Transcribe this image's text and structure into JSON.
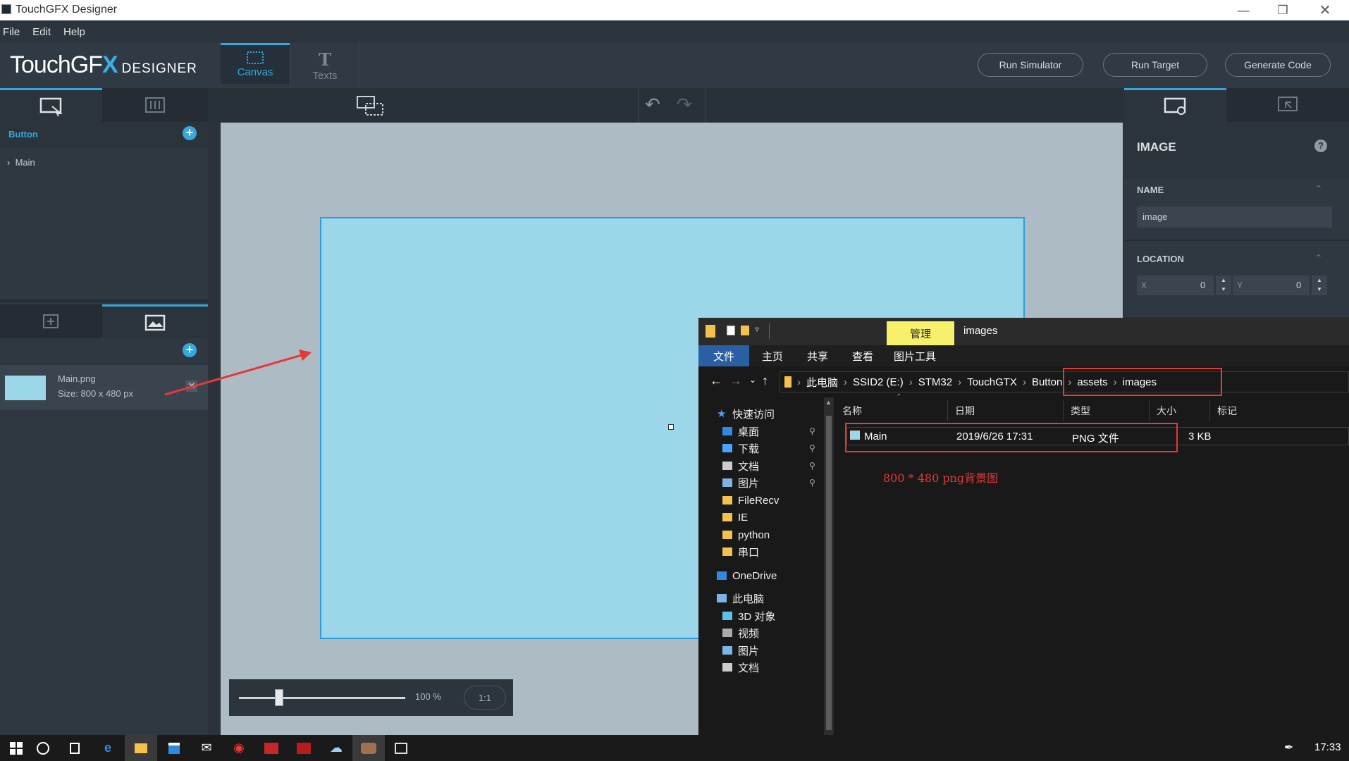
{
  "window": {
    "title": "TouchGFX Designer"
  },
  "menu": {
    "items": [
      "File",
      "Edit",
      "Help"
    ]
  },
  "header": {
    "logo_text": "TouchGF",
    "logo_x": "X",
    "logo_sub": "DESIGNER",
    "tabs": [
      {
        "label": "Canvas",
        "icon": "canvas-icon"
      },
      {
        "label": "Texts",
        "icon": "text-icon"
      }
    ],
    "buttons": [
      "Run Simulator",
      "Run Target",
      "Generate Code"
    ]
  },
  "left": {
    "project": "Button",
    "tree": [
      {
        "label": "Main"
      }
    ],
    "image": {
      "name": "Main.png",
      "size": "Size: 800 x 480 px"
    }
  },
  "zoom": {
    "percent": "100 %",
    "ratio": "1:1",
    "slider_fraction": 0.24
  },
  "properties": {
    "section_title": "IMAGE",
    "help": "?",
    "name_label": "NAME",
    "name_value": "image",
    "location_label": "LOCATION",
    "x_label": "X",
    "x_value": "0",
    "y_label": "Y",
    "y_value": "0"
  },
  "explorer": {
    "manage_tab": "管理",
    "folder_title": "images",
    "ribbon_tabs": [
      "文件",
      "主页",
      "共享",
      "查看",
      "图片工具"
    ],
    "breadcrumb": [
      "此电脑",
      "SSID2 (E:)",
      "STM32",
      "TouchGTX",
      "Button",
      "assets",
      "images"
    ],
    "columns": [
      "名称",
      "日期",
      "类型",
      "大小",
      "标记"
    ],
    "files": [
      {
        "name": "Main",
        "date": "2019/6/26 17:31",
        "type": "PNG 文件",
        "size": "3 KB"
      }
    ],
    "annotation": "800 * 480 png背景图",
    "sidebar": [
      {
        "label": "快速访问",
        "icon": "star-icon",
        "pinned": false
      },
      {
        "label": "桌面",
        "icon": "desktop-icon",
        "pinned": true
      },
      {
        "label": "下载",
        "icon": "download-icon",
        "pinned": true
      },
      {
        "label": "文档",
        "icon": "document-icon",
        "pinned": true
      },
      {
        "label": "图片",
        "icon": "pictures-icon",
        "pinned": true
      },
      {
        "label": "FileRecv",
        "icon": "folder-icon",
        "pinned": false
      },
      {
        "label": "IE",
        "icon": "folder-icon",
        "pinned": false
      },
      {
        "label": "python",
        "icon": "folder-icon",
        "pinned": false
      },
      {
        "label": "串口",
        "icon": "folder-icon",
        "pinned": false
      },
      {
        "label": "OneDrive",
        "icon": "cloud-icon",
        "pinned": false
      },
      {
        "label": "此电脑",
        "icon": "computer-icon",
        "pinned": false
      },
      {
        "label": "3D 对象",
        "icon": "cube-icon",
        "pinned": false
      },
      {
        "label": "视频",
        "icon": "video-icon",
        "pinned": false
      },
      {
        "label": "图片",
        "icon": "pictures-icon",
        "pinned": false
      },
      {
        "label": "文档",
        "icon": "document-icon",
        "pinned": false
      }
    ]
  },
  "taskbar": {
    "time": "17:33"
  },
  "colors": {
    "accent": "#35a8df",
    "highlight": "#e53935",
    "screen": "#9bd7e8"
  }
}
